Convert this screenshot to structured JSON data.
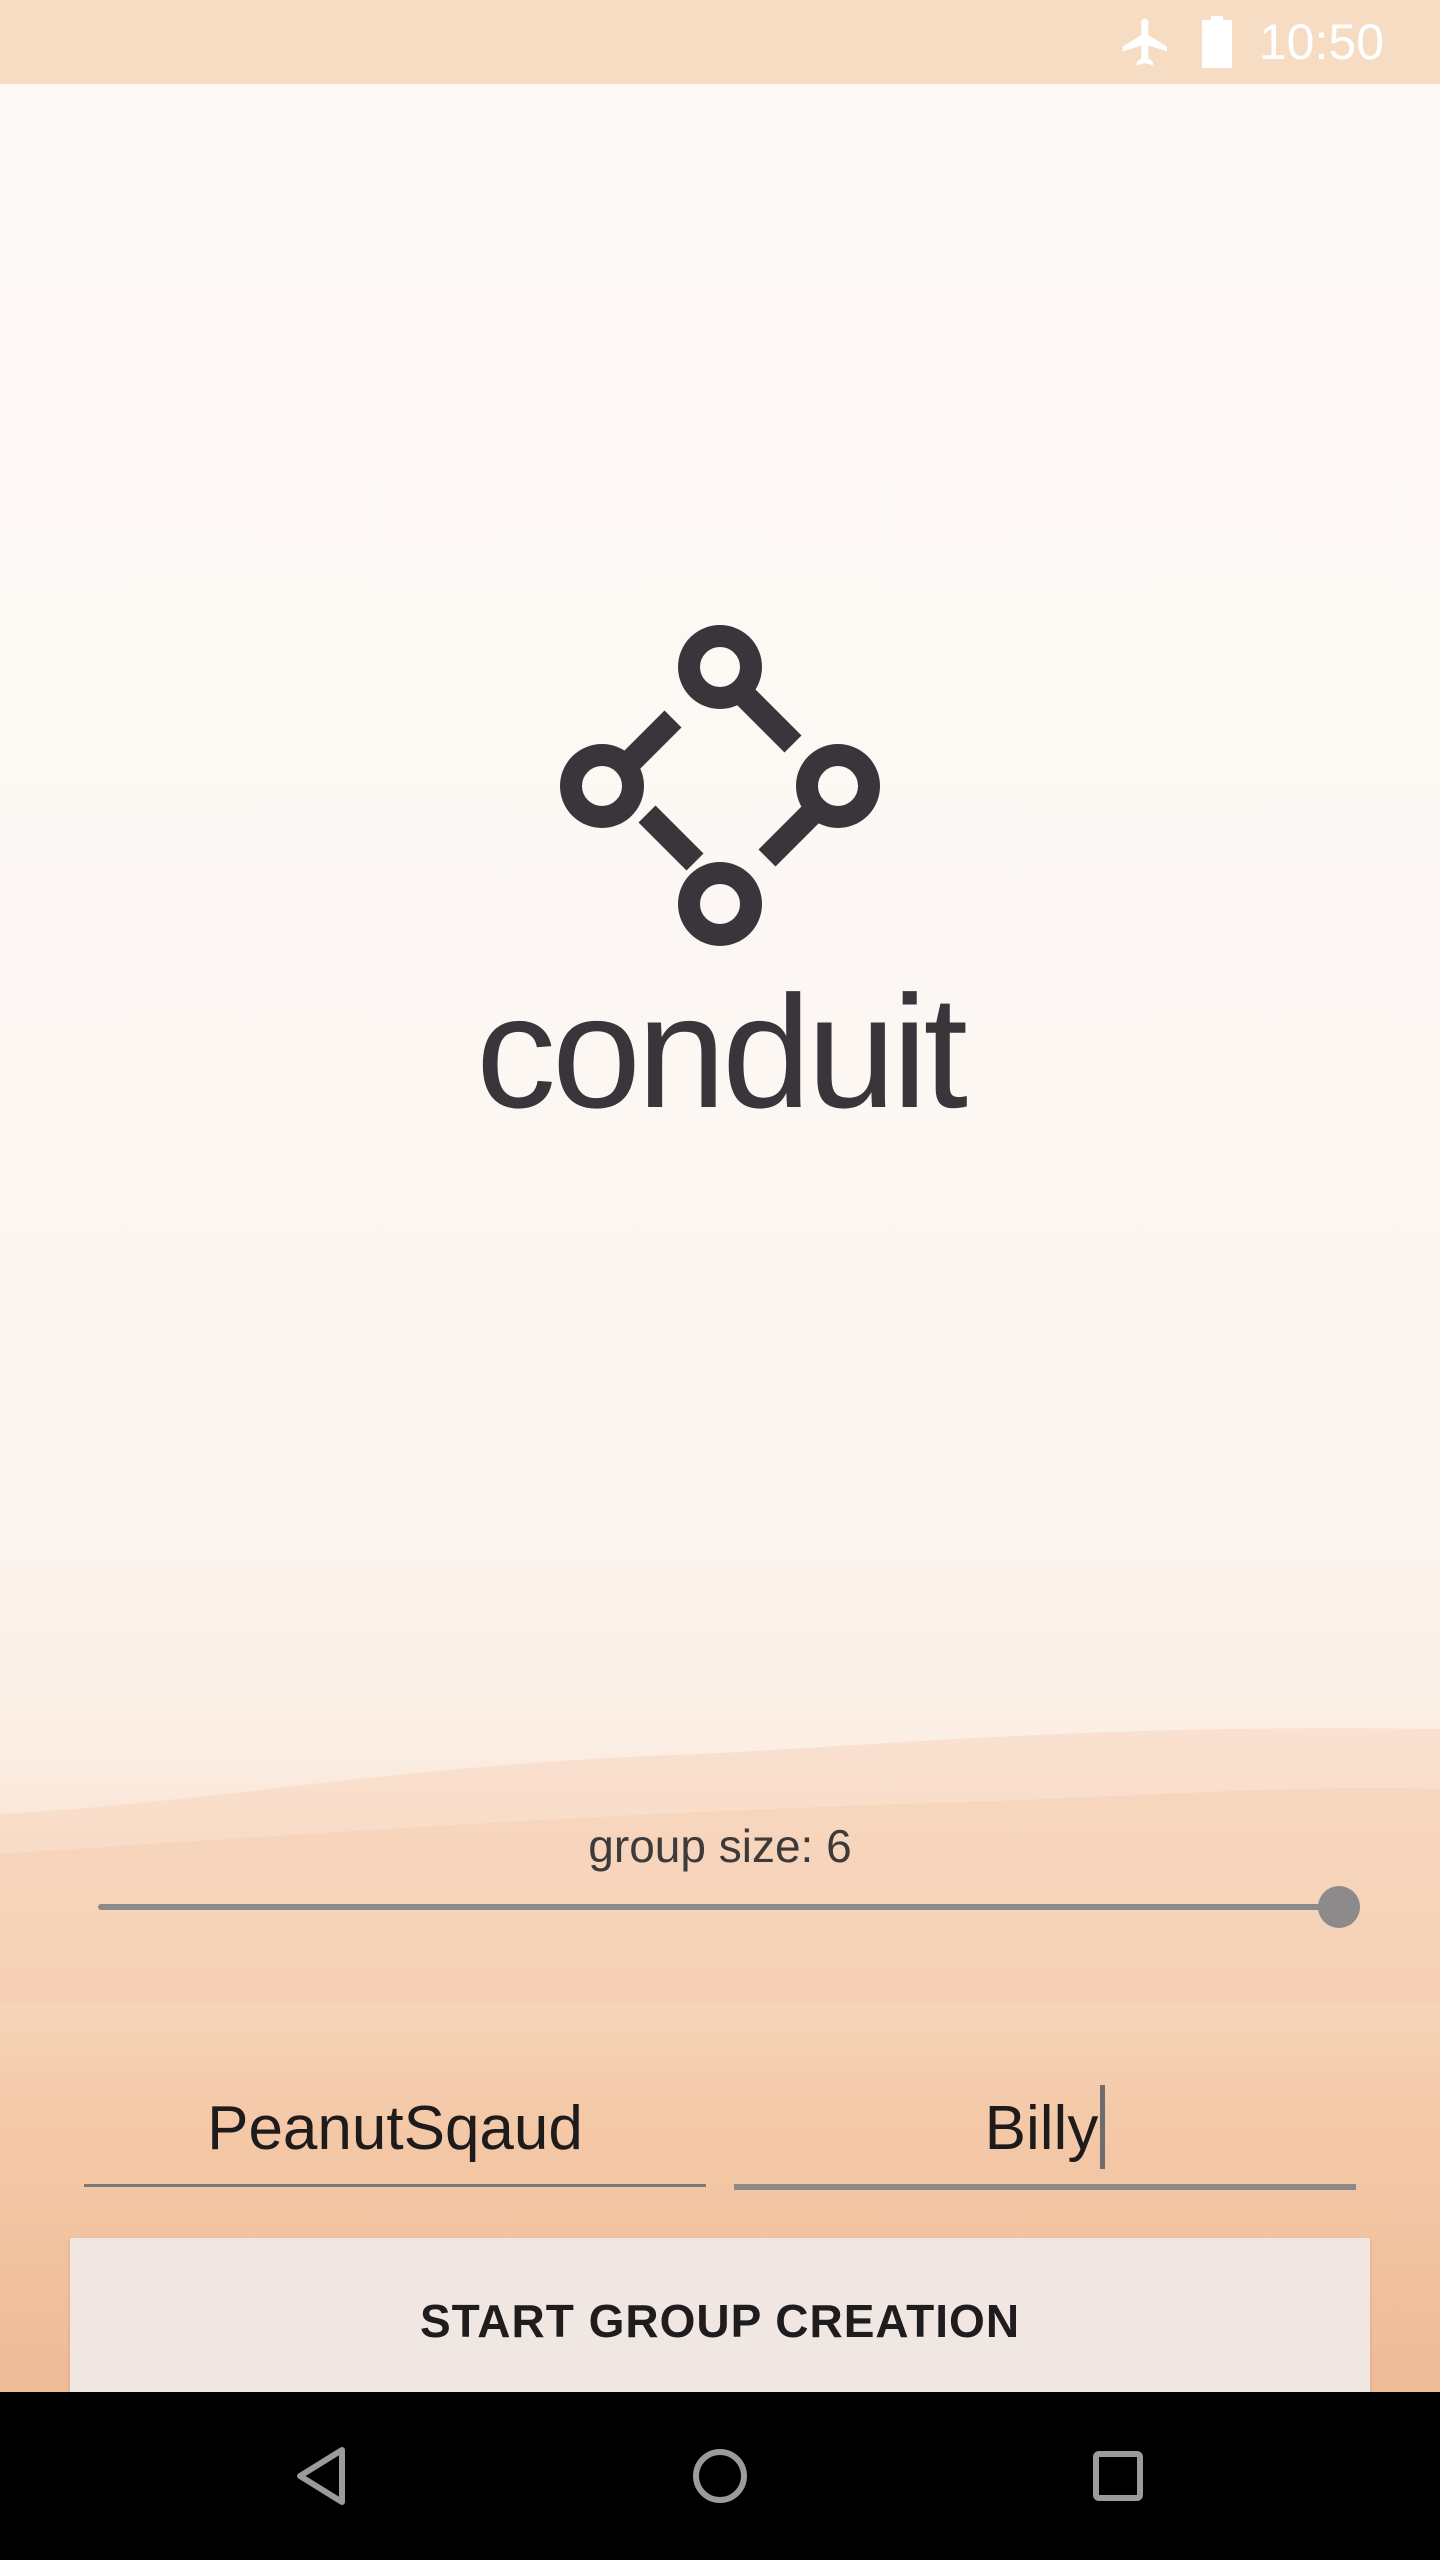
{
  "status_bar": {
    "time": "10:50",
    "icons": [
      "airplane-mode-icon",
      "battery-full-icon"
    ]
  },
  "app": {
    "logo_icon": "conduit-logo-icon",
    "wordmark": "conduit"
  },
  "group_size": {
    "label": "group size: 6",
    "value": 6,
    "slider_fraction": 1.0
  },
  "fields": {
    "group_name": "PeanutSqaud",
    "user_name": "Billy"
  },
  "actions": {
    "start_label": "START GROUP CREATION"
  },
  "nav_bar": {
    "icons": [
      "back-icon",
      "home-icon",
      "recents-icon"
    ]
  },
  "colors": {
    "status_bar": "#f5dcc3",
    "logo": "#39353a",
    "button_bg": "#f1e7e2",
    "slider": "#8c8a8a"
  }
}
